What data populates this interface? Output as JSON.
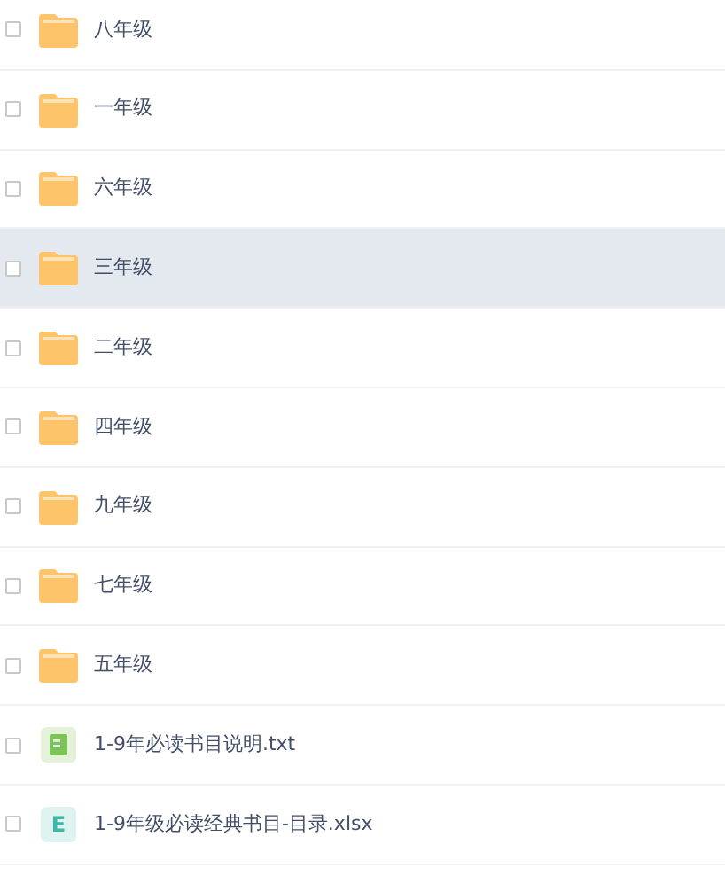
{
  "files": [
    {
      "kind": "folder",
      "name": "八年级",
      "checked": false,
      "selected": false
    },
    {
      "kind": "folder",
      "name": "一年级",
      "checked": false,
      "selected": false
    },
    {
      "kind": "folder",
      "name": "六年级",
      "checked": false,
      "selected": false
    },
    {
      "kind": "folder",
      "name": "三年级",
      "checked": false,
      "selected": true
    },
    {
      "kind": "folder",
      "name": "二年级",
      "checked": false,
      "selected": false
    },
    {
      "kind": "folder",
      "name": "四年级",
      "checked": false,
      "selected": false
    },
    {
      "kind": "folder",
      "name": "九年级",
      "checked": false,
      "selected": false
    },
    {
      "kind": "folder",
      "name": "七年级",
      "checked": false,
      "selected": false
    },
    {
      "kind": "folder",
      "name": "五年级",
      "checked": false,
      "selected": false
    },
    {
      "kind": "text",
      "name": "1-9年必读书目说明.txt",
      "checked": false,
      "selected": false
    },
    {
      "kind": "sheet",
      "name": "1-9年级必读经典书目-目录.xlsx",
      "icon_letter": "E",
      "checked": false,
      "selected": false
    }
  ]
}
